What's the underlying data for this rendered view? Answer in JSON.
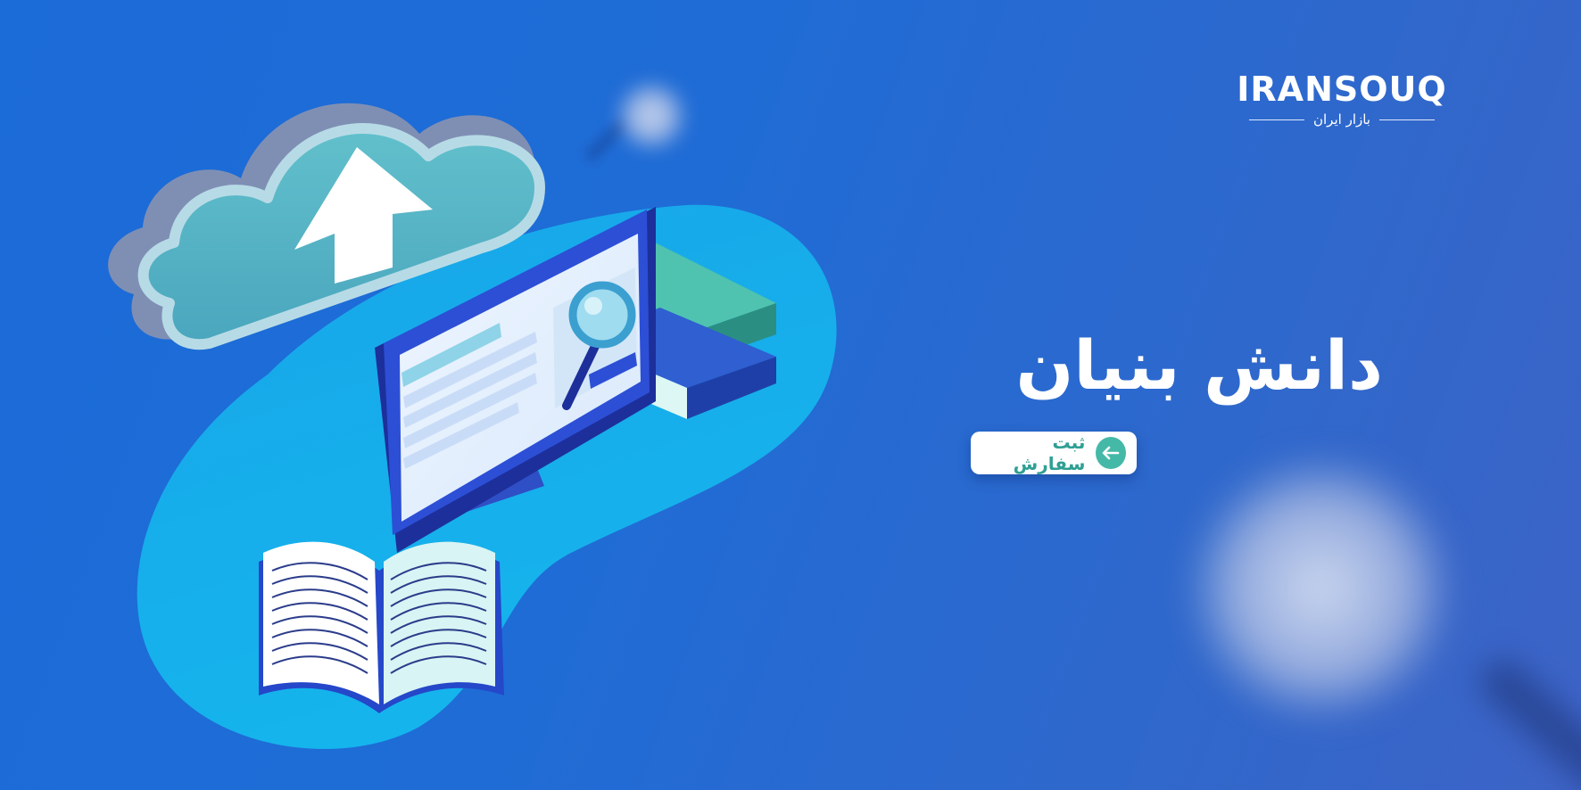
{
  "banner": {
    "headline": "دانش بنیان",
    "cta": {
      "label": "ثبت سفارش",
      "icon": "arrow-left-icon"
    }
  },
  "logo": {
    "wordmark": "IRANSOUQ",
    "subtitle": "بازار ایران"
  },
  "illustration": {
    "icons": [
      "cloud-upload-icon",
      "monitor-icon",
      "magnifier-icon",
      "book-stack-icon",
      "open-book-icon"
    ]
  },
  "colors": {
    "background": "#1f6cd6",
    "blob": "#12b4ec",
    "cloud": "#5bb8c6",
    "monitor_frame": "#2547c9",
    "books_teal": "#4fc3b0",
    "cta_accent": "#45b9a8",
    "text": "#ffffff"
  }
}
